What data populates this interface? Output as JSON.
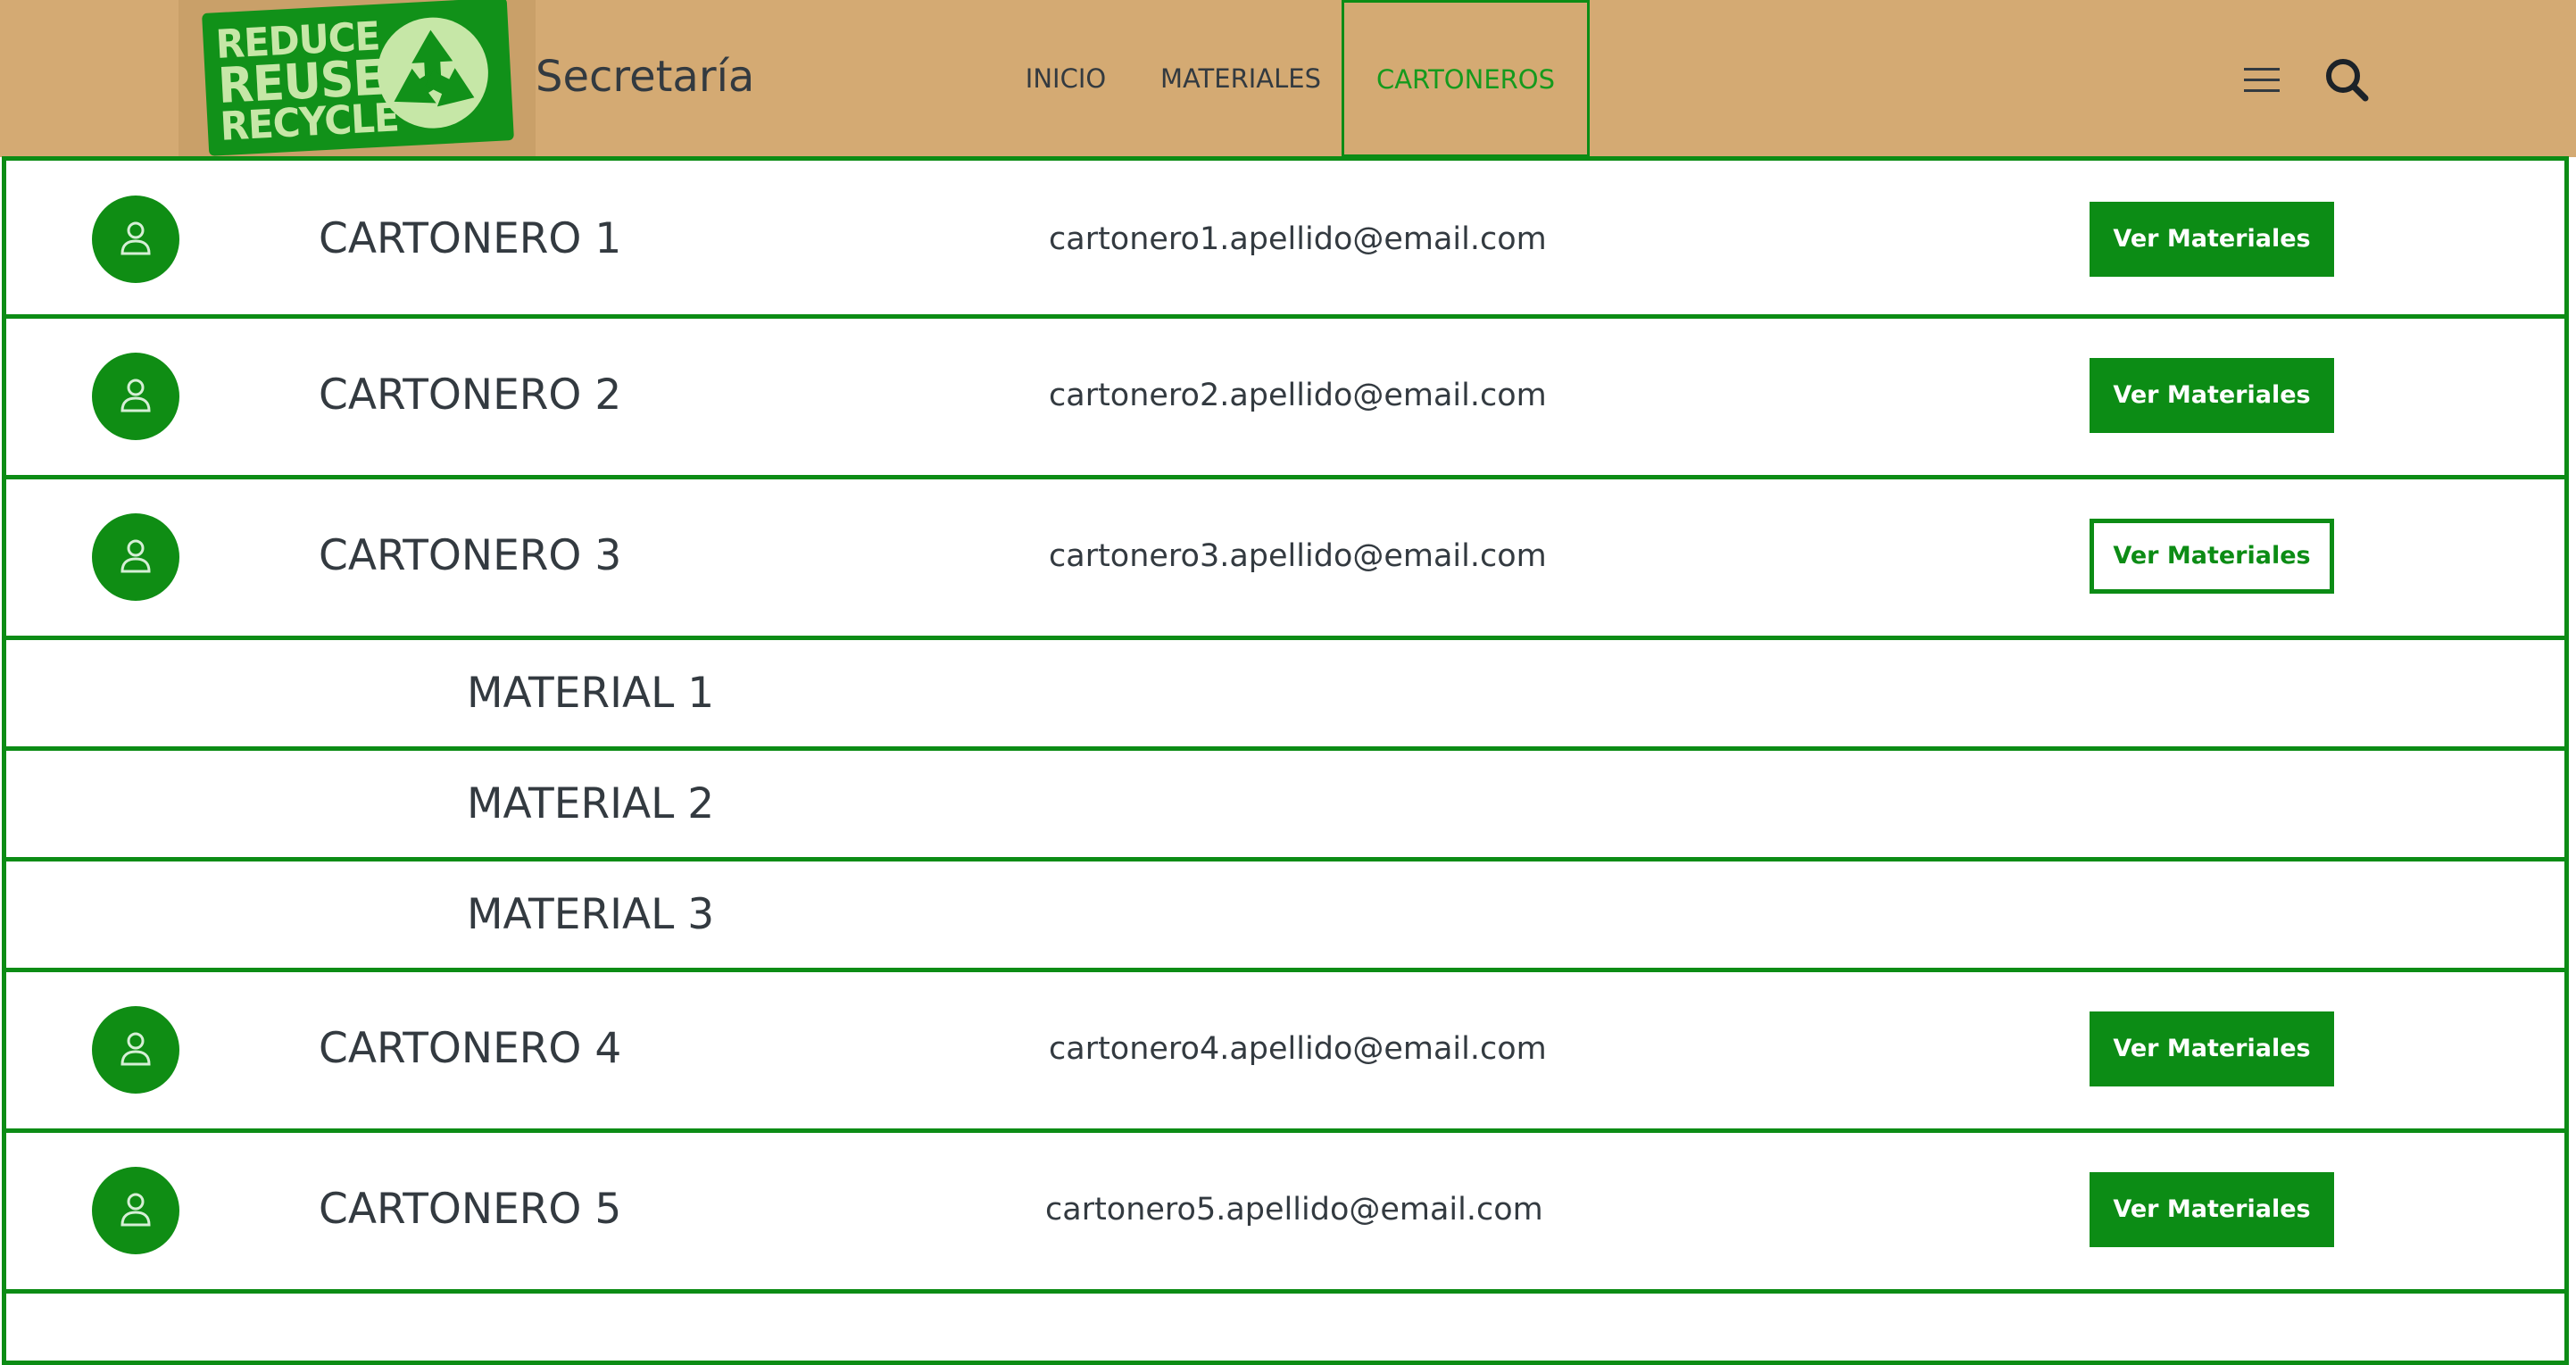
{
  "header": {
    "logo_words": [
      "REDUCE",
      "REUSE",
      "RECYCLE"
    ],
    "brand": "Secretaría",
    "nav": [
      {
        "label": "INICIO"
      },
      {
        "label": "MATERIALES"
      },
      {
        "label": "CARTONEROS",
        "active": true
      }
    ]
  },
  "cartoneros": [
    {
      "name": "CARTONERO 1",
      "email": "cartonero1.apellido@email.com",
      "button": "Ver Materiales"
    },
    {
      "name": "CARTONERO 2",
      "email": "cartonero2.apellido@email.com",
      "button": "Ver Materiales"
    },
    {
      "name": "CARTONERO 3",
      "email": "cartonero3.apellido@email.com",
      "button": "Ver Materiales",
      "expanded": true
    },
    {
      "name": "CARTONERO 4",
      "email": "cartonero4.apellido@email.com",
      "button": "Ver Materiales"
    },
    {
      "name": "CARTONERO 5",
      "email": "cartonero5.apellido@email.com",
      "button": "Ver Materiales"
    }
  ],
  "materiales": [
    "MATERIAL 1",
    "MATERIAL 2",
    "MATERIAL 3"
  ],
  "colors": {
    "accent": "#0c8c15",
    "header_bg": "#d4aa73",
    "text": "#333a40"
  },
  "icons": [
    "user-icon",
    "hamburger-menu-icon",
    "search-icon",
    "recycle-icon"
  ]
}
